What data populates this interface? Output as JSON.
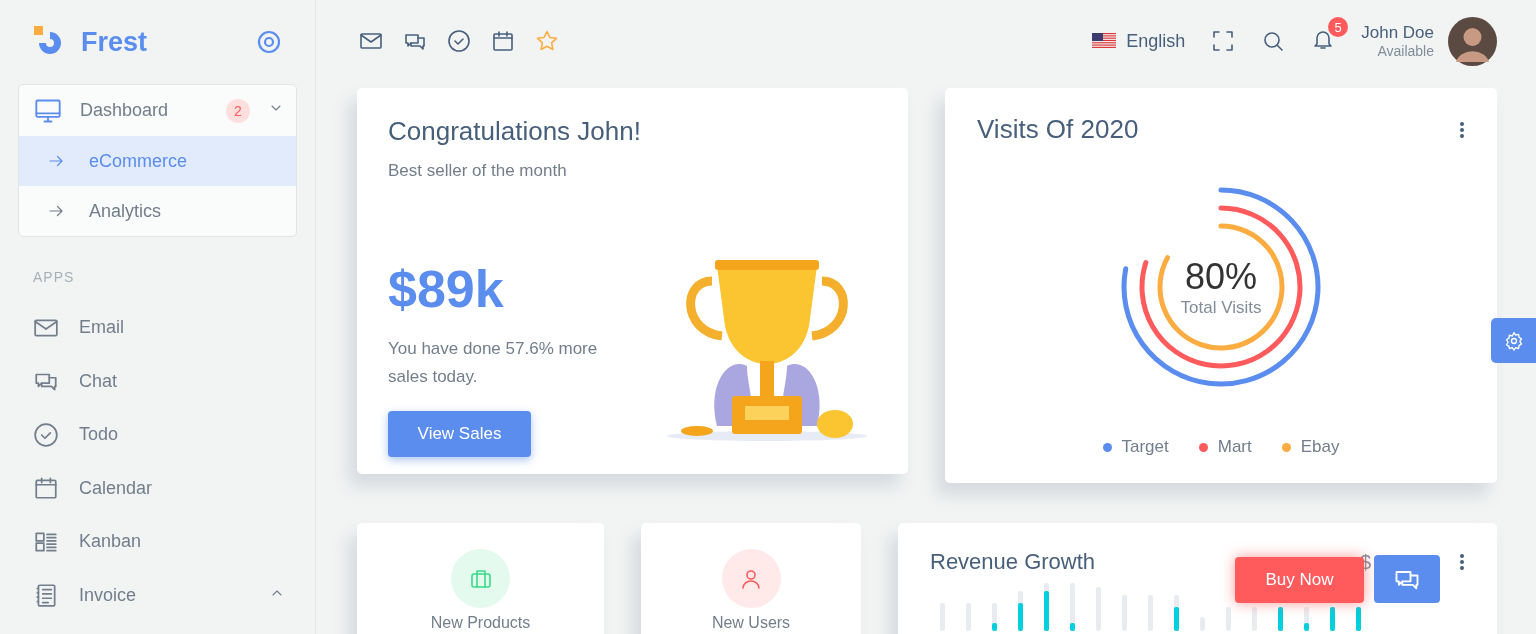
{
  "brand": {
    "name": "Frest"
  },
  "sidebar": {
    "menu": [
      {
        "label": "Dashboard",
        "badge": "2",
        "expanded": true,
        "children": [
          {
            "label": "eCommerce",
            "selected": true
          },
          {
            "label": "Analytics",
            "selected": false
          }
        ]
      }
    ],
    "section": "APPS",
    "items": [
      {
        "label": "Email"
      },
      {
        "label": "Chat"
      },
      {
        "label": "Todo"
      },
      {
        "label": "Calendar"
      },
      {
        "label": "Kanban"
      },
      {
        "label": "Invoice",
        "expanded": false
      }
    ]
  },
  "header": {
    "language": "English",
    "notifications": "5",
    "user": {
      "name": "John Doe",
      "status": "Available"
    }
  },
  "congrats": {
    "title": "Congratulations John!",
    "subtitle": "Best seller of the month",
    "amount": "$89k",
    "text": "You have done 57.6% more sales today.",
    "button": "View Sales"
  },
  "visits": {
    "title": "Visits Of 2020",
    "value": "80%",
    "label": "Total Visits",
    "legend": [
      {
        "label": "Target",
        "color": "#5a8dee"
      },
      {
        "label": "Mart",
        "color": "#ff5b5c"
      },
      {
        "label": "Ebay",
        "color": "#fdac41"
      }
    ]
  },
  "stats": [
    {
      "label": "New Products",
      "color": "#39da8a"
    },
    {
      "label": "New Users",
      "color": "#ff5b5c"
    }
  ],
  "revenue": {
    "title": "Revenue Growth",
    "value": "$"
  },
  "floating": {
    "buy": "Buy Now"
  }
}
